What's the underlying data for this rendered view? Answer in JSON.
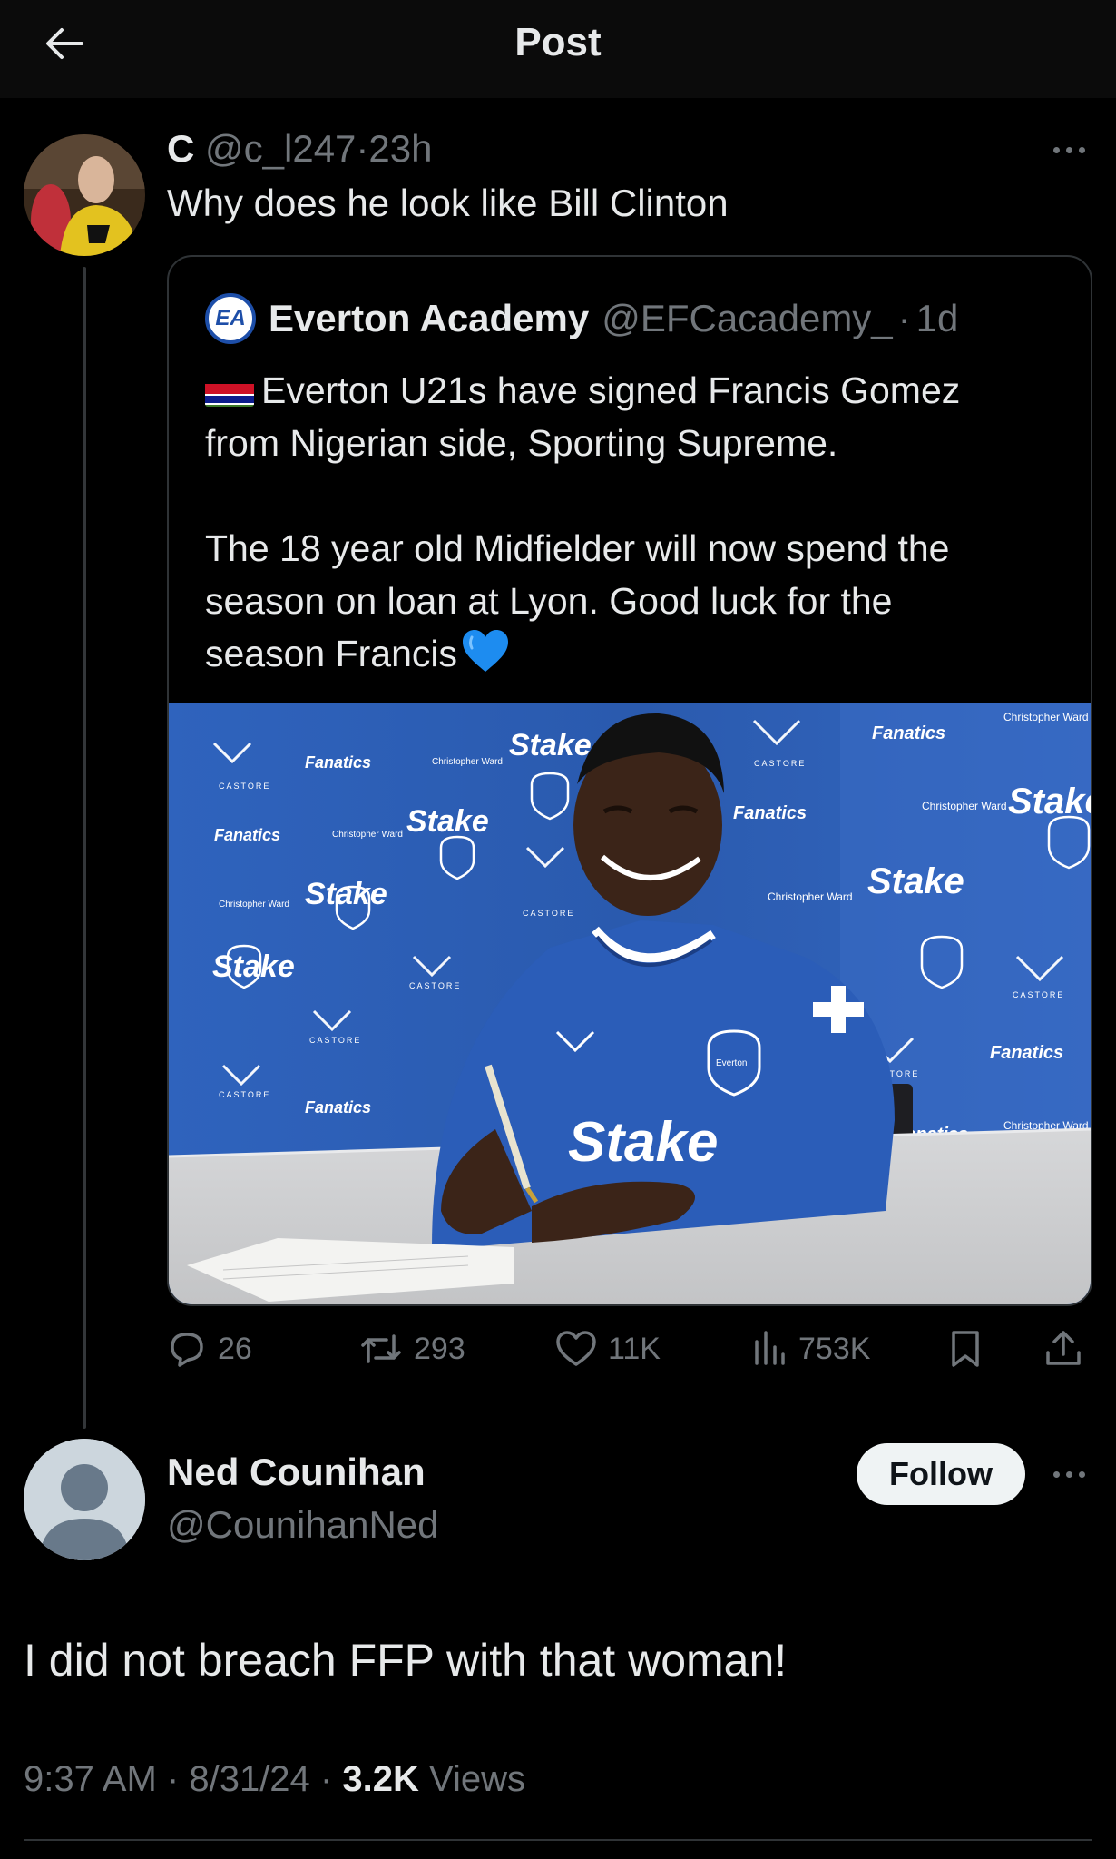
{
  "header": {
    "title": "Post"
  },
  "reply": {
    "name": "C",
    "handle": "@c_l247",
    "sep": "·",
    "time": "23h",
    "text": "Why does he look like Bill Clinton"
  },
  "quote": {
    "name": "Everton Academy",
    "handle": "@EFCacademy_",
    "sep": "·",
    "time": "1d",
    "logo_text": "EA",
    "line1": "Everton U21s have signed Francis Gomez",
    "line2": "from Nigerian side, Sporting Supreme.",
    "line3": "The 18 year old Midfielder will now spend the",
    "line4": "season on loan at Lyon. Good luck for the",
    "line5": "season Francis",
    "photo_texts": {
      "stake": "Stake",
      "fanatics": "Fanatics",
      "castore": "CASTORE",
      "christopher_ward": "Christopher Ward",
      "everton": "Everton"
    }
  },
  "actions": {
    "replies": "26",
    "reposts": "293",
    "likes": "11K",
    "views": "753K"
  },
  "post": {
    "name": "Ned Counihan",
    "handle": "@CounihanNed",
    "follow_label": "Follow",
    "text": "I did not breach FFP with that woman!",
    "time": "9:37 AM",
    "sep1": "·",
    "date": "8/31/24",
    "sep2": "·",
    "views_count": "3.2K",
    "views_label": "Views"
  },
  "colors": {
    "background": "#000000",
    "text": "#e7e9ea",
    "muted": "#71767b",
    "border": "#2f3336",
    "everton_blue": "#2a5db3",
    "follow_bg": "#eff3f4"
  }
}
